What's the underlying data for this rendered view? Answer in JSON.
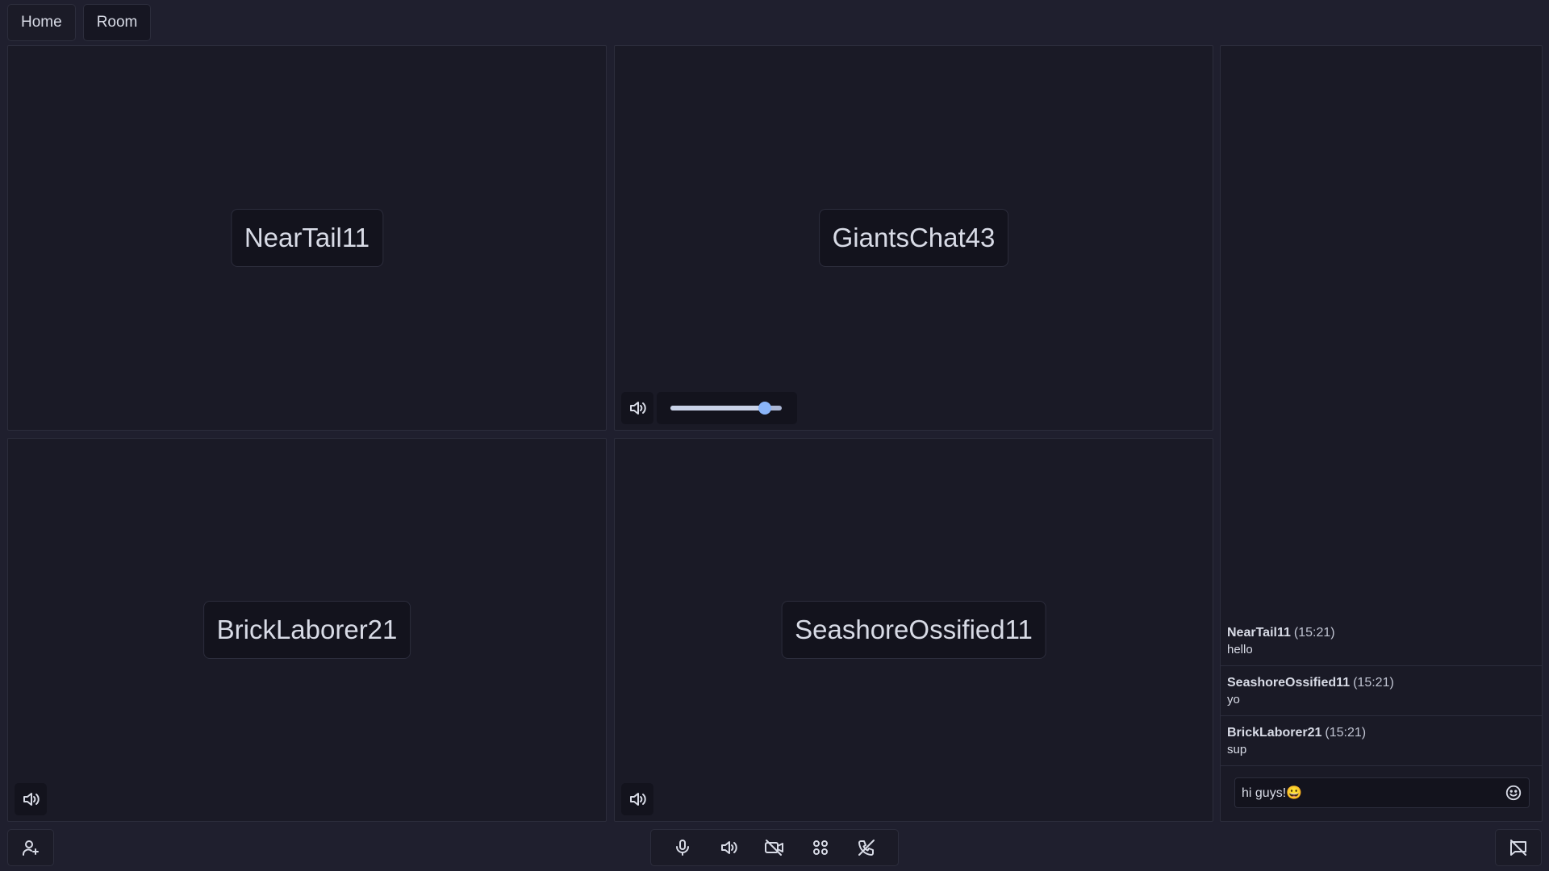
{
  "nav": {
    "home_label": "Home",
    "room_label": "Room"
  },
  "participants": [
    {
      "name": "NearTail11"
    },
    {
      "name": "GiantsChat43",
      "volume_percent": 85
    },
    {
      "name": "BrickLaborer21"
    },
    {
      "name": "SeashoreOssified11"
    }
  ],
  "chat": {
    "messages": [
      {
        "author": "NearTail11",
        "time": "(15:21)",
        "text": "hello"
      },
      {
        "author": "SeashoreOssified11",
        "time": "(15:21)",
        "text": "yo"
      },
      {
        "author": "BrickLaborer21",
        "time": "(15:21)",
        "text": "sup"
      }
    ],
    "input_value": "hi guys!😀"
  },
  "controls": {
    "icons": [
      "microphone-icon",
      "speaker-icon",
      "camera-off-icon",
      "grid-view-icon",
      "hang-up-icon"
    ]
  },
  "colors": {
    "background": "#1f1f2e",
    "tile": "#1a1a26",
    "accent": "#8ab4f8"
  }
}
